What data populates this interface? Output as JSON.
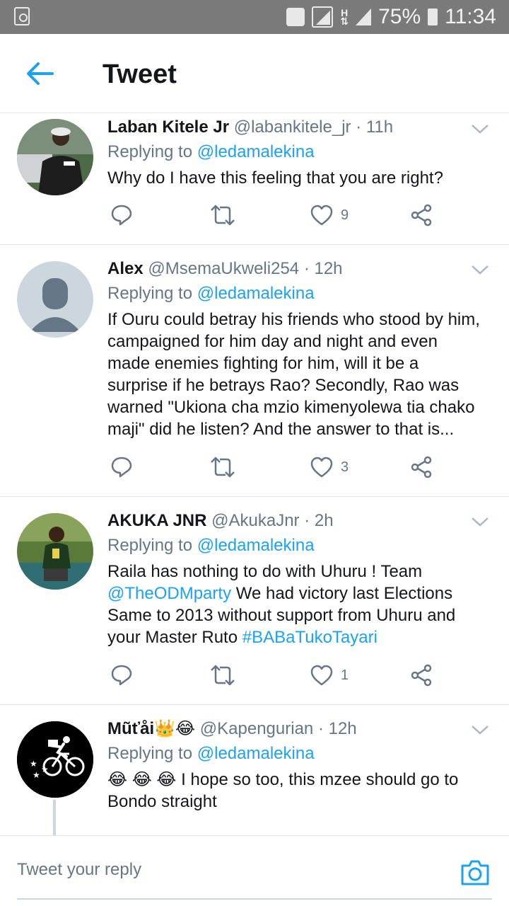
{
  "status_bar": {
    "battery": "75%",
    "time": "11:34"
  },
  "header": {
    "title": "Tweet"
  },
  "tweets": [
    {
      "name": "Laban Kitele Jr",
      "handle": "@labankitele_jr",
      "time": "· 11h",
      "replying_prefix": "Replying to",
      "replying_to": "@ledamalekina",
      "text": "Why do I have this feeling that you are right?",
      "likes": "9"
    },
    {
      "name": "Alex",
      "handle": "@MsemaUkweli254",
      "time": "· 12h",
      "replying_prefix": "Replying to",
      "replying_to": "@ledamalekina",
      "text": "If Ouru could betray his friends who stood by him, campaigned for him day and night and even made enemies fighting for him, will it be a surprise if he betrays Rao? Secondly, Rao was warned \"Ukiona cha mzio kimenyolewa tia chako maji\" did he listen? And the answer to that is...",
      "likes": "3"
    },
    {
      "name": "AKUKA JNR",
      "handle": "@AkukaJnr",
      "time": "· 2h",
      "replying_prefix": "Replying to",
      "replying_to": "@ledamalekina",
      "text_part1": "Raila has nothing to do with Uhuru ! Team",
      "text_link1": "@TheODMparty",
      "text_part2": " We had victory last Elections Same to 2013 without support from Uhuru and your Master Ruto ",
      "text_link2": "#BABaTukoTayari",
      "likes": "1"
    },
    {
      "name": "Mũťåi",
      "name_emoji": "👑😂",
      "handle": "@Kapengurian",
      "time": "· 12h",
      "replying_prefix": "Replying to",
      "replying_to": "@ledamalekina",
      "text_emoji": "😂 😂 😂",
      "text": " I hope so too, this mzee should go to Bondo straight"
    }
  ],
  "reply_bar": {
    "placeholder": "Tweet your reply"
  },
  "colors": {
    "accent": "#1da1f2",
    "secondary_text": "#657786",
    "divider": "#e1e8ed"
  }
}
